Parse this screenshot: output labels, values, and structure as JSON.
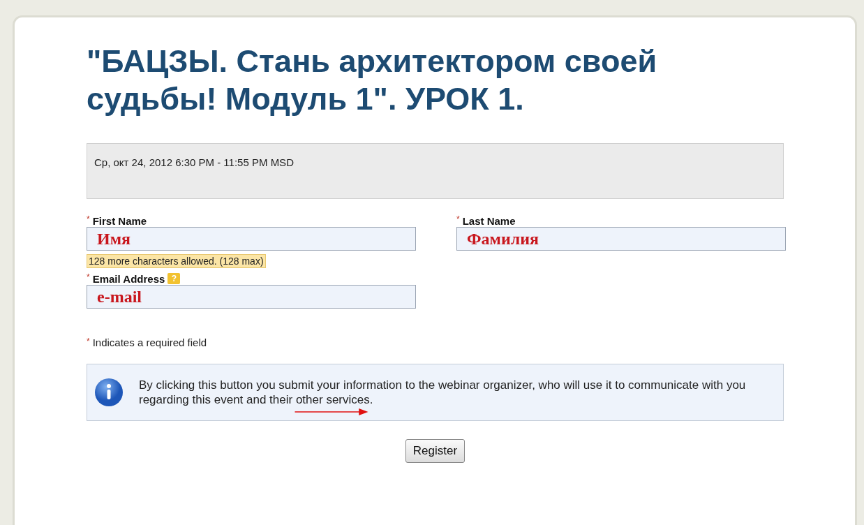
{
  "title": "\"БАЦЗЫ. Стань архитектором своей судьбы! Модуль 1\". УРОК 1.",
  "schedule": "Ср, окт 24, 2012 6:30 PM - 11:55 PM MSD",
  "fields": [
    {
      "label": "First Name",
      "required_mark": "*",
      "value": "Имя",
      "hint": "128 more characters allowed. (128 max)"
    },
    {
      "label": "Last Name",
      "required_mark": "*",
      "value": "Фамилия"
    },
    {
      "label": "Email Address",
      "required_mark": "*",
      "value": "e-mail",
      "help": "?"
    }
  ],
  "required_note": {
    "mark": "*",
    "text": "Indicates a required field"
  },
  "info": "By clicking this button you submit your information to the webinar organizer, who will use it to communicate with you regarding this event and their other services.",
  "register_button": "Register"
}
